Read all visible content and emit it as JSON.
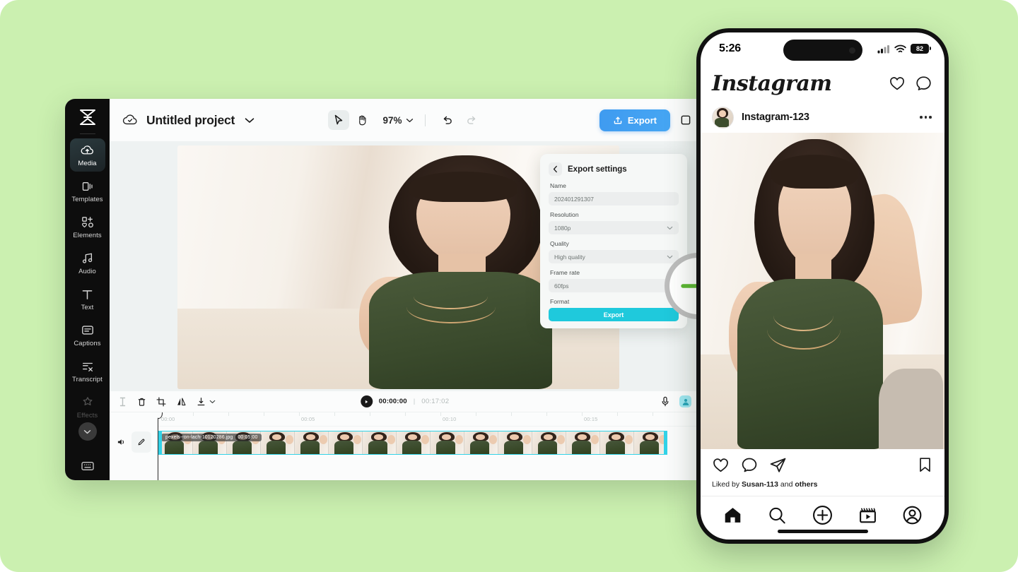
{
  "background_color": "#cbf0b0",
  "editor": {
    "app_logo_icon": "capcut-logo-icon",
    "sidebar": {
      "items": [
        {
          "label": "Media",
          "icon": "cloud-upload-icon",
          "active": true,
          "dim": false
        },
        {
          "label": "Templates",
          "icon": "templates-icon",
          "active": false,
          "dim": false
        },
        {
          "label": "Elements",
          "icon": "elements-icon",
          "active": false,
          "dim": false
        },
        {
          "label": "Audio",
          "icon": "audio-note-icon",
          "active": false,
          "dim": false
        },
        {
          "label": "Text",
          "icon": "text-t-icon",
          "active": false,
          "dim": false
        },
        {
          "label": "Captions",
          "icon": "captions-icon",
          "active": false,
          "dim": false
        },
        {
          "label": "Transcript",
          "icon": "transcript-icon",
          "active": false,
          "dim": false
        },
        {
          "label": "Effects",
          "icon": "effects-star-icon",
          "active": false,
          "dim": true
        }
      ],
      "collapse_icon": "chevron-down-icon",
      "bottom_icon": "keyboard-shortcuts-icon"
    },
    "topbar": {
      "cloud_icon": "cloud-saved-icon",
      "project_title": "Untitled project",
      "title_caret_icon": "chevron-down-icon",
      "tools": [
        {
          "name": "select-tool",
          "icon": "cursor-arrow-icon",
          "selected": true
        },
        {
          "name": "hand-tool",
          "icon": "hand-icon",
          "selected": false
        }
      ],
      "zoom_level": "97%",
      "zoom_caret_icon": "chevron-down-icon",
      "undo_icon": "undo-icon",
      "redo_icon": "redo-icon",
      "export_label": "Export",
      "export_icon": "export-upload-icon",
      "export_color": "#41a0f1"
    },
    "export_panel": {
      "back_icon": "chevron-left-icon",
      "title": "Export settings",
      "fields": [
        {
          "label": "Name",
          "value": "202401291307",
          "has_caret": false
        },
        {
          "label": "Resolution",
          "value": "1080p",
          "has_caret": true
        },
        {
          "label": "Quality",
          "value": "High quality",
          "has_caret": true
        },
        {
          "label": "Frame rate",
          "value": "60fps",
          "has_caret": false
        },
        {
          "label": "Format",
          "value": "",
          "has_caret": false
        }
      ],
      "export_label": "Export",
      "export_color": "#1fc9dc"
    },
    "timeline": {
      "tools": [
        {
          "name": "split-tool",
          "icon": "split-icon"
        },
        {
          "name": "delete-tool",
          "icon": "trash-icon"
        },
        {
          "name": "crop-tool",
          "icon": "crop-icon"
        },
        {
          "name": "mirror-tool",
          "icon": "mirror-icon"
        },
        {
          "name": "download-tool",
          "icon": "download-icon"
        }
      ],
      "download_caret_icon": "chevron-down-icon",
      "play_icon": "play-icon",
      "current_time": "00:00:00",
      "time_separator": "|",
      "total_time": "00:17:02",
      "mic_icon": "microphone-icon",
      "avatar_icon": "user-avatar-icon",
      "track_volume_icon": "speaker-icon",
      "track_edit_icon": "pencil-edit-icon",
      "ruler_marks": [
        "00:00",
        "00:05",
        "00:10",
        "00:15"
      ],
      "clip": {
        "filename": "pexels-ron-lach-10120286.jpg",
        "duration": "00:05:00",
        "accent_color": "#33d3e8"
      }
    }
  },
  "arrow_badge": {
    "icon": "arrow-right-icon",
    "color": "#5cb832"
  },
  "phone": {
    "status_bar": {
      "time": "5:26",
      "signal_icon": "cellular-signal-icon",
      "wifi_icon": "wifi-icon",
      "battery_level": "82"
    },
    "instagram": {
      "logo_text": "Instagram",
      "header_icons": [
        {
          "name": "heart-icon"
        },
        {
          "name": "messenger-icon"
        }
      ],
      "post": {
        "avatar_icon": "user-avatar-image",
        "username": "Instagram-123",
        "more_icon": "more-options-icon",
        "actions": [
          {
            "name": "like-heart-icon"
          },
          {
            "name": "comment-bubble-icon"
          },
          {
            "name": "share-paperplane-icon"
          }
        ],
        "save_icon": "bookmark-icon",
        "likes_prefix": "Liked by",
        "likes_user": "Susan-113",
        "likes_suffix": "and",
        "likes_others": "others"
      },
      "tabbar": [
        {
          "name": "tab-home",
          "icon": "home-icon"
        },
        {
          "name": "tab-search",
          "icon": "search-icon"
        },
        {
          "name": "tab-create",
          "icon": "plus-circle-icon"
        },
        {
          "name": "tab-reels",
          "icon": "reels-icon"
        },
        {
          "name": "tab-profile",
          "icon": "profile-icon"
        }
      ]
    }
  }
}
